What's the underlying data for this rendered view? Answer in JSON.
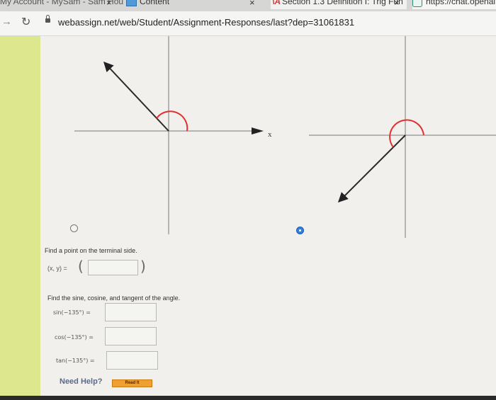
{
  "browser": {
    "tabs": [
      {
        "label": "My Account - MySam - Sam Hou",
        "close": "×"
      },
      {
        "label": "Content",
        "close": "×"
      },
      {
        "label": "Section 1.3 Definition I: Trig Fun",
        "close": "×"
      },
      {
        "label": "https://chat.openai.c"
      }
    ],
    "url": "webassign.net/web/Student/Assignment-Responses/last?dep=31061831"
  },
  "graph": {
    "axis_label": "x"
  },
  "question": {
    "point_prompt": "Find a point on the terminal side.",
    "point_label": "(x, y) =",
    "point_value": "",
    "trig_prompt": "Find the sine, cosine, and tangent of the angle.",
    "rows": [
      {
        "label": "sin(−135°) =",
        "value": ""
      },
      {
        "label": "cos(−135°) =",
        "value": ""
      },
      {
        "label": "tan(−135°) =",
        "value": ""
      }
    ],
    "open_paren": "(",
    "close_paren": ")"
  },
  "help": {
    "label": "Need Help?",
    "read_button": "Read It"
  },
  "colors": {
    "accent_arc": "#e03030",
    "radio_selected": "#2f7fe0",
    "sidebar": "#dde78e"
  }
}
